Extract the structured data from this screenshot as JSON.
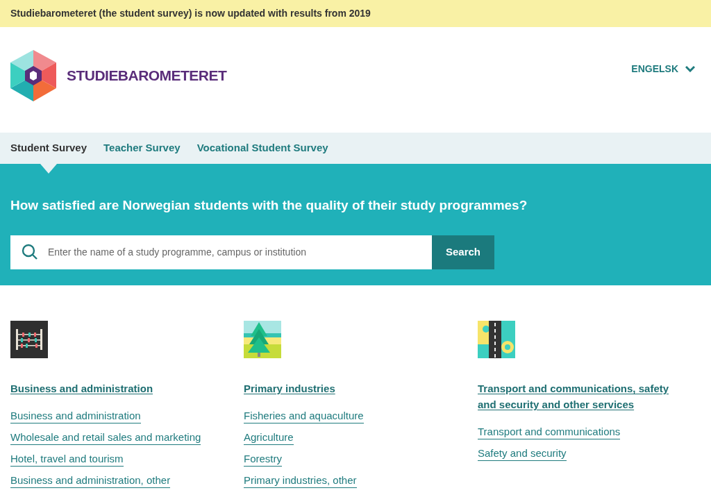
{
  "notice": "Studiebarometeret (the student survey) is now updated with results from 2019",
  "logo": {
    "text": "STUDIEBAROMETERET"
  },
  "language": {
    "label": "ENGELSK",
    "expanded": false
  },
  "tabs": [
    {
      "label": "Student Survey",
      "selected": true
    },
    {
      "label": "Teacher Survey",
      "selected": false
    },
    {
      "label": "Vocational Student Survey",
      "selected": false
    }
  ],
  "hero": {
    "title": "How satisfied are Norwegian students with the quality of their study programmes?",
    "search": {
      "placeholder": "Enter the name of a study programme, campus or institution"
    },
    "button": "Search"
  },
  "categories": [
    {
      "kind": "abacus",
      "title": "Business and administration",
      "links": [
        "Business and administration",
        "Wholesale and retail sales and marketing",
        "Hotel, travel and tourism",
        "Business and administration, other"
      ]
    },
    {
      "kind": "tree",
      "title": "Primary industries",
      "links": [
        "Fisheries and aquaculture",
        "Agriculture",
        "Forestry",
        "Primary industries, other"
      ]
    },
    {
      "kind": "road",
      "title": "Transport and communications, safety and security and other services",
      "links": [
        "Transport and communications",
        "Safety and security"
      ]
    }
  ]
}
